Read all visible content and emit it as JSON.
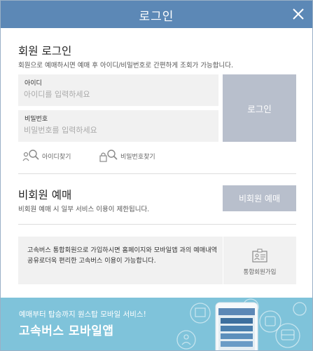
{
  "header": {
    "title": "로그인",
    "close_label": "close"
  },
  "member": {
    "title": "회원 로그인",
    "description": "회원으로 예매하시면 예매 후 아이디/비밀번호로 간편하게 조회가 가능합니다.",
    "id_field": {
      "label": "아이디",
      "placeholder": "아이디를 입력하세요",
      "value": ""
    },
    "pw_field": {
      "label": "비밀번호",
      "placeholder": "비밀번호를 입력하세요",
      "value": ""
    },
    "login_button": "로그인",
    "find_id": "아이디찾기",
    "find_pw": "비밀번호찾기"
  },
  "guest": {
    "title": "비회원 예매",
    "description": "비회원 예매 시 일부 서비스 이용이 제한됩니다.",
    "button": "비회원 예매"
  },
  "integrated": {
    "text": "고속버스 통합회원으로 가입하시면 홈페이지와 모바일앱 과의 예매내역 공유로더욱 편리한 고속버스 이용이 가능합니다.",
    "join_label": "통합회원가입"
  },
  "banner": {
    "subtitle": "예매부터 탑승까지 원스탑 모바일 서비스!",
    "title": "고속버스 모바일앱"
  },
  "colors": {
    "header": "#5c88b6",
    "button": "#b8bfcc",
    "banner": "#7fc3da",
    "field_bg": "#f1f1f1"
  },
  "icons": [
    "close-icon",
    "person-search-icon",
    "lock-search-icon",
    "id-card-icon",
    "phone-app-icon"
  ]
}
